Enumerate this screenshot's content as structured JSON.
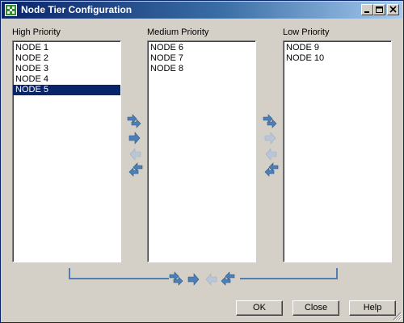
{
  "window": {
    "title": "Node Tier Configuration"
  },
  "tiers": {
    "high": {
      "label": "High Priority",
      "items": [
        "NODE 1",
        "NODE 2",
        "NODE 3",
        "NODE 4",
        "NODE 5"
      ],
      "selected": "NODE 5"
    },
    "medium": {
      "label": "Medium Priority",
      "items": [
        "NODE 6",
        "NODE 7",
        "NODE 8"
      ]
    },
    "low": {
      "label": "Low Priority",
      "items": [
        "NODE 9",
        "NODE 10"
      ]
    }
  },
  "arrows": {
    "between_high_medium": [
      "move-all-right-icon",
      "move-right-icon",
      "move-left-icon (disabled)",
      "move-all-left-icon"
    ],
    "between_medium_low": [
      "move-all-right-icon",
      "move-right-icon (disabled)",
      "move-left-icon (disabled)",
      "move-all-left-icon"
    ],
    "high_low": [
      "move-all-right-icon",
      "move-right-icon",
      "move-left-icon (disabled)",
      "move-all-left-icon"
    ]
  },
  "buttons": {
    "ok": "OK",
    "close": "Close",
    "help": "Help"
  },
  "colors": {
    "selection": "#0a246a",
    "arrow": "#4d7fb6",
    "arrow_disabled": "#b8c6d8",
    "connector": "#4d7fb6"
  }
}
